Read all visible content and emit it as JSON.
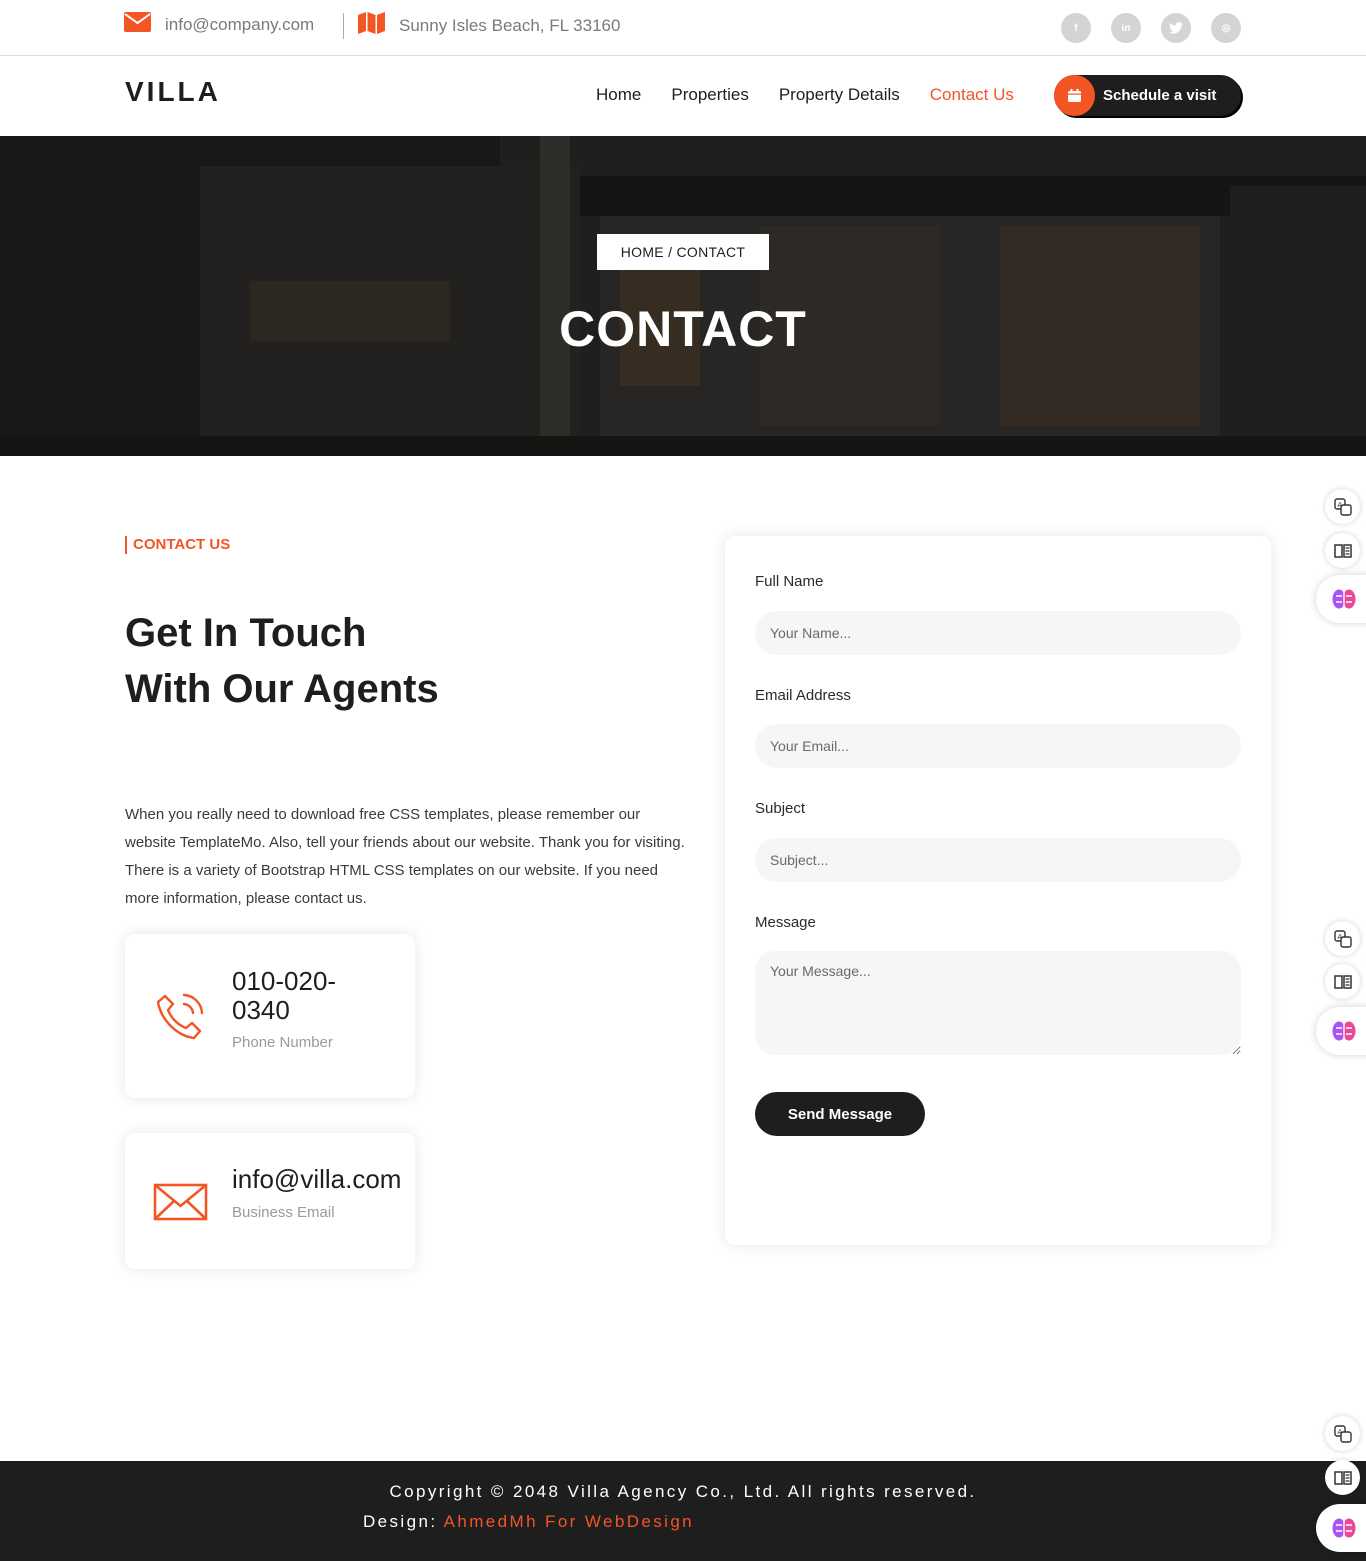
{
  "colors": {
    "accent": "#f35525",
    "dark": "#1e1e1e",
    "muted": "#9a9a9a",
    "field_bg": "#f6f6f6"
  },
  "topbar": {
    "email": "info@company.com",
    "address": "Sunny Isles Beach, FL 33160",
    "socials": [
      {
        "icon": "facebook-icon",
        "glyph": "f"
      },
      {
        "icon": "linkedin-icon",
        "glyph": "in"
      },
      {
        "icon": "twitter-icon",
        "glyph": "t"
      },
      {
        "icon": "instagram-icon",
        "glyph": "◎"
      }
    ]
  },
  "header": {
    "logo": "VILLA",
    "nav": [
      "Home",
      "Properties",
      "Property Details",
      "Contact Us"
    ],
    "active_nav": "Contact Us",
    "schedule_button": "Schedule a visit"
  },
  "hero": {
    "breadcrumb": "HOME / CONTACT",
    "title": "CONTACT"
  },
  "contact": {
    "tag": "CONTACT US",
    "heading": "Get In Touch With Our Agents",
    "intro": "When you really need to download free CSS templates, please remember our website TemplateMo. Also, tell your friends about our website. Thank you for visiting. There is a variety of Bootstrap HTML CSS templates on our website. If you need more information, please contact us.",
    "phone": {
      "value": "010-020-0340",
      "label": "Phone Number"
    },
    "email": {
      "value": "info@villa.com",
      "label": "Business Email"
    }
  },
  "form": {
    "name_label": "Full Name",
    "name_placeholder": "Your Name...",
    "email_label": "Email Address",
    "email_placeholder": "Your Email...",
    "subject_label": "Subject",
    "subject_placeholder": "Subject...",
    "message_label": "Message",
    "message_placeholder": "Your Message...",
    "submit": "Send Message"
  },
  "footer": {
    "copyright": "Copyright © 2048 Villa Agency Co., Ltd. All rights reserved.",
    "design_prefix": "Design:",
    "design_author": "AhmedMh For WebDesign"
  }
}
